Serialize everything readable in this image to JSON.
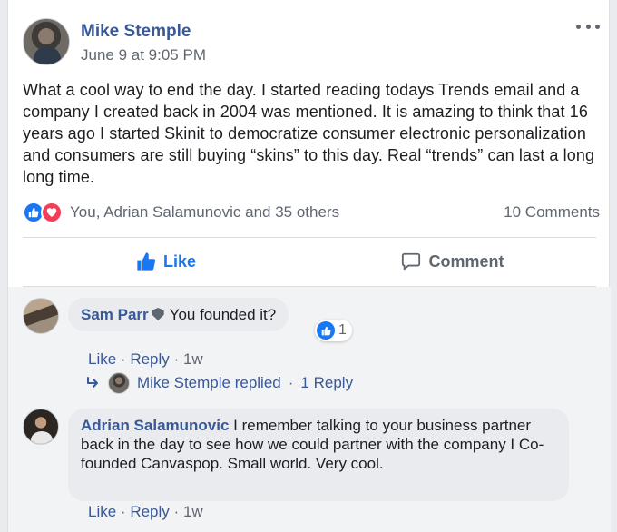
{
  "post": {
    "author": "Mike Stemple",
    "timestamp": "June 9 at 9:05 PM",
    "body": "What a cool way to end the day. I started reading todays Trends email and a company I created back in 2004 was mentioned. It is amazing to think that 16 years ago I started Skinit to democratize consumer electronic personalization and consumers are still buying “skins” to this day. Real “trends” can last a long long time.",
    "reactions_summary": "You, Adrian Salamunovic and 35 others",
    "comments_count": "10 Comments",
    "reaction_icons": [
      "like-icon",
      "love-icon"
    ]
  },
  "actions": {
    "like_label": "Like",
    "comment_label": "Comment"
  },
  "comments": [
    {
      "author": "Sam Parr",
      "text": "You founded it?",
      "reaction_count": "1",
      "like_label": "Like",
      "reply_label": "Reply",
      "age": "1w",
      "replies_author": "Mike Stemple replied",
      "replies_count": "1 Reply"
    },
    {
      "author": "Adrian Salamunovic",
      "text": "I remember talking to your business partner back in the day to see how we could partner with the company I Co-founded Canvaspop. Small world. Very cool.",
      "like_label": "Like",
      "reply_label": "Reply",
      "age": "1w"
    }
  ],
  "separators": {
    "dot": "·"
  },
  "colors": {
    "link": "#385898",
    "accent": "#1877f2",
    "love": "#f33e58",
    "muted": "#606770"
  }
}
